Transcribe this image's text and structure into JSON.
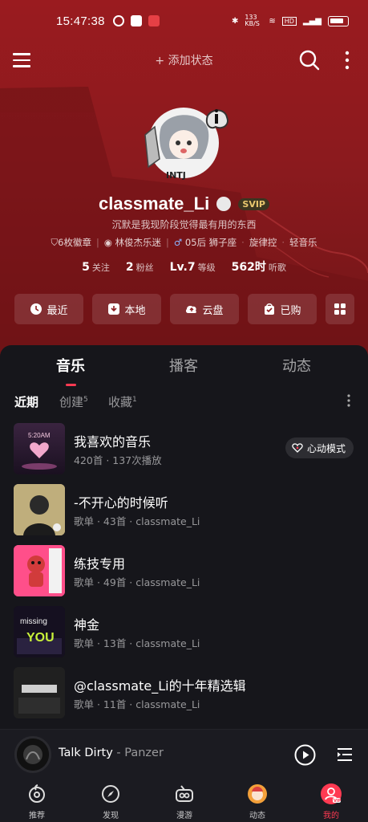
{
  "status_bar": {
    "time": "15:47:38",
    "net_speed": "133 KB/S"
  },
  "topbar": {
    "add_status": "+ 添加状态"
  },
  "profile": {
    "avatar_tag": "INTJ",
    "username": "classmate_Li",
    "vip_badge": "SVIP",
    "bio": "沉默是我现阶段觉得最有用的东西",
    "tags": [
      "6枚徽章",
      "林俊杰乐迷",
      "05后 狮子座",
      "旋律控",
      "轻音乐"
    ],
    "stats": [
      {
        "value": "5",
        "label": "关注"
      },
      {
        "value": "2",
        "label": "粉丝"
      },
      {
        "value": "Lv.7",
        "label": "等级"
      },
      {
        "value": "562时",
        "label": "听歌"
      }
    ]
  },
  "quick_actions": [
    {
      "label": "最近",
      "icon": "clock-icon"
    },
    {
      "label": "本地",
      "icon": "download-icon"
    },
    {
      "label": "云盘",
      "icon": "cloud-upload-icon"
    },
    {
      "label": "已购",
      "icon": "bag-check-icon"
    },
    {
      "label": "",
      "icon": "grid-icon"
    }
  ],
  "tabs": [
    "音乐",
    "播客",
    "动态"
  ],
  "subtabs": [
    {
      "label": "近期",
      "count": ""
    },
    {
      "label": "创建",
      "count": "5"
    },
    {
      "label": "收藏",
      "count": "1"
    }
  ],
  "playlists": [
    {
      "title": "我喜欢的音乐",
      "subtitle": "420首 · 137次播放",
      "cover_text": "5:20AM",
      "action": "心动模式"
    },
    {
      "title": "-不开心的时候听",
      "subtitle": "歌单 · 43首 · classmate_Li"
    },
    {
      "title": "练技专用",
      "subtitle": "歌单 · 49首 · classmate_Li"
    },
    {
      "title": "神金",
      "subtitle": "歌单 · 13首 · classmate_Li",
      "cover_text": "missing YOU"
    },
    {
      "title": "@classmate_Li的十年精选辑",
      "subtitle": "歌单 · 11首 · classmate_Li"
    }
  ],
  "player": {
    "track": "Talk Dirty",
    "artist": "- Panzer"
  },
  "bottom_nav": [
    {
      "label": "推荐",
      "icon": "netease-logo-icon"
    },
    {
      "label": "发现",
      "icon": "compass-icon"
    },
    {
      "label": "漫游",
      "icon": "radio-icon"
    },
    {
      "label": "动态",
      "icon": "avatar-feed-icon"
    },
    {
      "label": "我的",
      "icon": "user-vip-icon"
    }
  ],
  "colors": {
    "hero": "#8b1a1e",
    "accent": "#ff3a52",
    "panel": "#16161b",
    "gold": "#e9c76e"
  }
}
